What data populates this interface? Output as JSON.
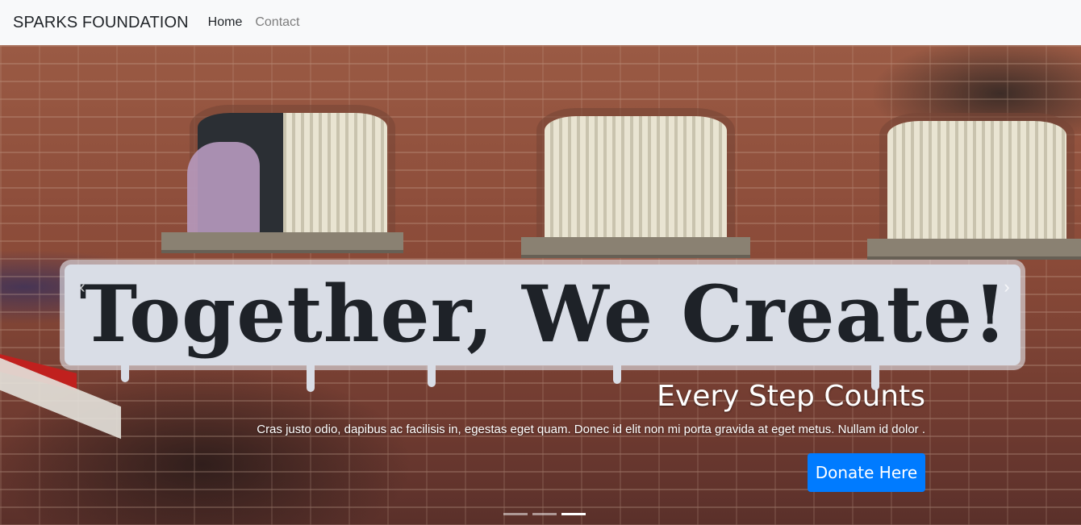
{
  "navbar": {
    "brand": "SPARKS FOUNDATION",
    "links": [
      {
        "label": "Home",
        "active": true
      },
      {
        "label": "Contact",
        "active": false
      }
    ]
  },
  "carousel": {
    "background_text": "Together, We Create!",
    "caption": {
      "title": "Every Step Counts",
      "text": "Cras justo odio, dapibus ac facilisis in, egestas eget quam. Donec id elit non mi porta gravida at eget metus. Nullam id dolor ."
    },
    "button_label": "Donate Here",
    "prev_icon": "chevron-left-icon",
    "next_icon": "chevron-right-icon",
    "indicator_count": 3,
    "active_indicator": 3
  },
  "colors": {
    "navbar_bg": "#f8f9fa",
    "primary": "#007bff",
    "brick": "#8a4a38"
  }
}
